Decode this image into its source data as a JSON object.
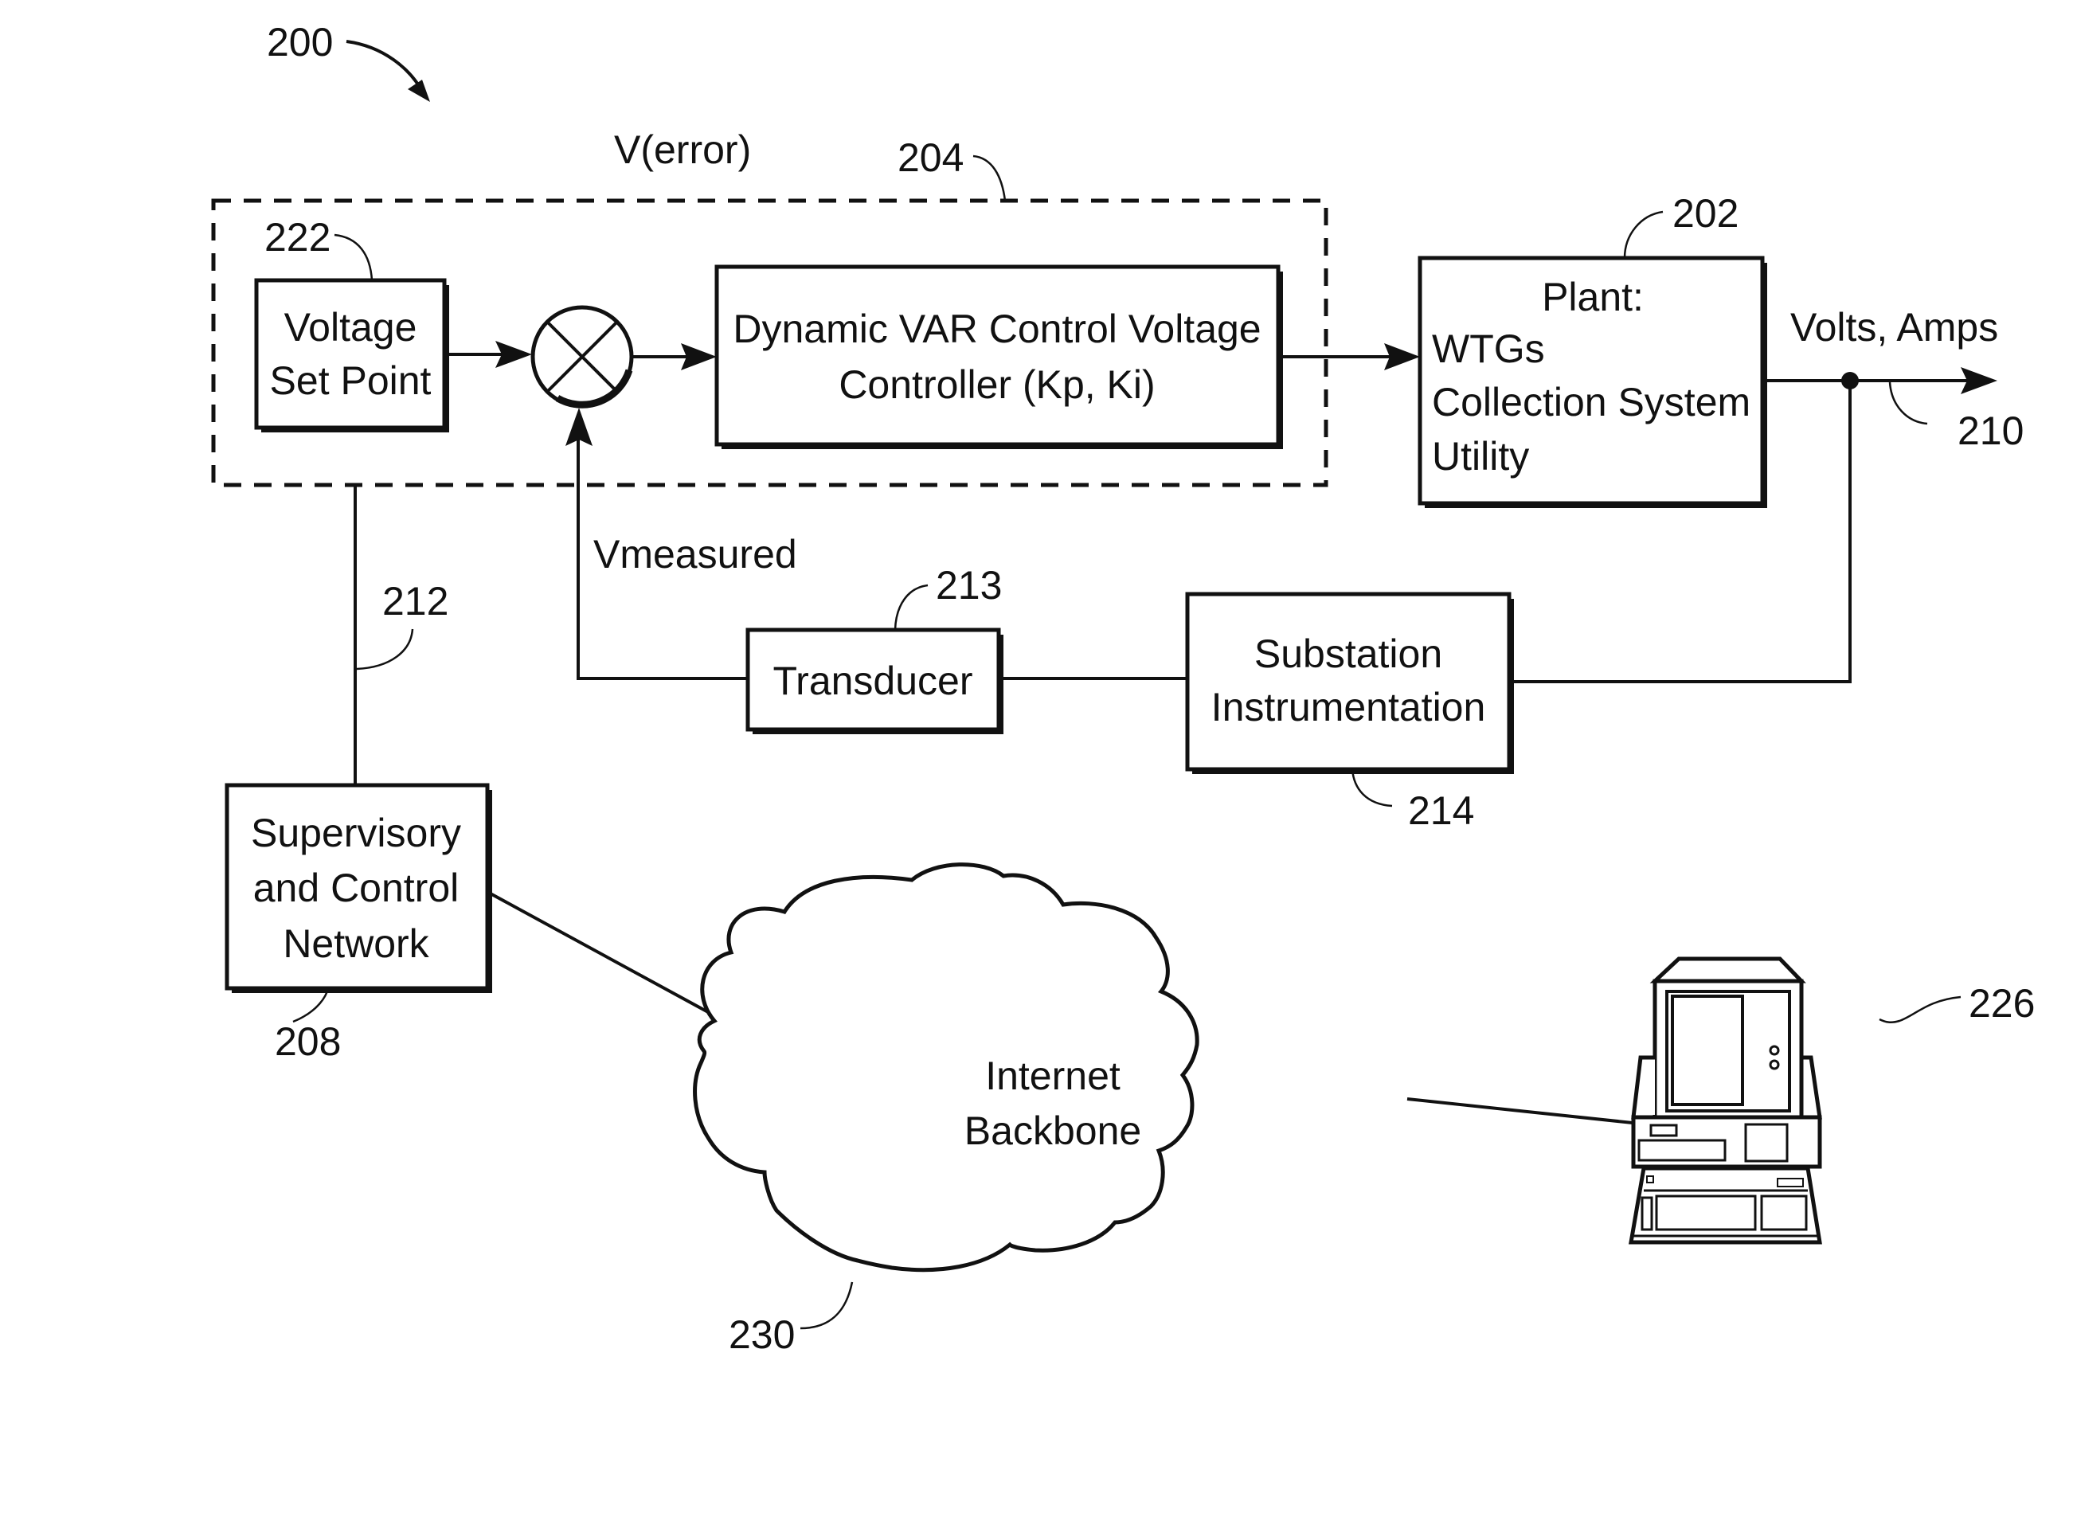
{
  "figure": {
    "ref_number": "200",
    "background": "#ffffff",
    "ink_color": "#111111"
  },
  "labels": {
    "v_error": "V(error)",
    "v_measured": "Vmeasured",
    "volts_amps": "Volts, Amps"
  },
  "blocks": {
    "voltage_set_point": {
      "lines": [
        "Voltage",
        "Set Point"
      ],
      "ref": "222"
    },
    "summing_junction": {
      "symbol": "⊗"
    },
    "controller": {
      "lines": [
        "Dynamic VAR Control Voltage",
        "Controller (Kp, Ki)"
      ]
    },
    "controller_group": {
      "ref": "204"
    },
    "plant": {
      "title": "Plant:",
      "lines": [
        "WTGs",
        "Collection System",
        "Utility"
      ],
      "ref": "202"
    },
    "transducer": {
      "lines": [
        "Transducer"
      ],
      "ref": "213"
    },
    "substation": {
      "lines": [
        "Substation",
        "Instrumentation"
      ],
      "ref": "214"
    },
    "supervisory": {
      "lines": [
        "Supervisory",
        "and Control",
        "Network"
      ],
      "ref": "208"
    },
    "internet": {
      "lines": [
        "Internet",
        "Backbone"
      ],
      "ref": "230"
    },
    "computer": {
      "ref": "226"
    }
  },
  "connections": {
    "output_ref": "210",
    "supervisory_link_ref": "212"
  }
}
